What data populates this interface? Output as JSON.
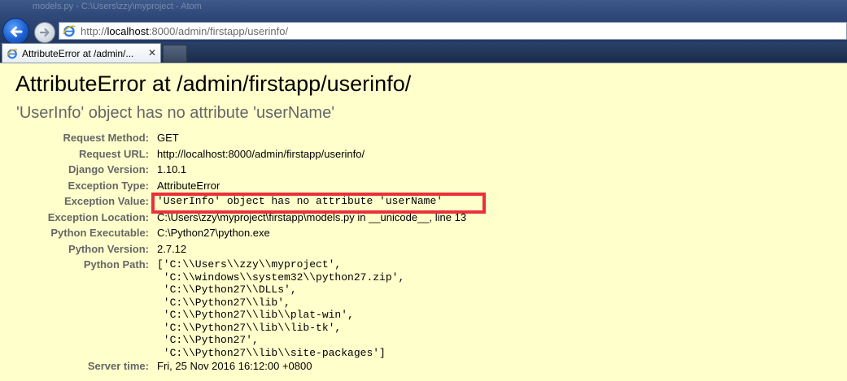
{
  "browser": {
    "window_title": "models.py - C:\\Users\\zzy\\myproject - Atom",
    "address_url": "http://localhost:8000/admin/firstapp/userinfo/",
    "url_scheme": "http://",
    "url_host": "localhost",
    "url_rest": ":8000/admin/firstapp/userinfo/",
    "tab_title": "AttributeError at /admin/...",
    "tab_close": "✕",
    "icons": [
      "back-arrow-icon",
      "forward-arrow-icon",
      "ie-page-icon",
      "ie-tab-icon",
      "tab-close-icon"
    ],
    "accent_color": "#1d5fd0"
  },
  "page": {
    "title": "AttributeError at /admin/firstapp/userinfo/",
    "subtitle": "'UserInfo' object has no attribute 'userName'",
    "background": "#ffffcc",
    "highlight_color": "#e8323a",
    "meta": [
      {
        "key": "Request Method:",
        "value": "GET"
      },
      {
        "key": "Request URL:",
        "value": "http://localhost:8000/admin/firstapp/userinfo/"
      },
      {
        "key": "Django Version:",
        "value": "1.10.1"
      },
      {
        "key": "Exception Type:",
        "value": "AttributeError"
      },
      {
        "key": "Exception Value:",
        "value": "'UserInfo' object has no attribute 'userName'"
      },
      {
        "key": "Exception Location:",
        "value": "C:\\Users\\zzy\\myproject\\firstapp\\models.py in __unicode__, line 13"
      },
      {
        "key": "Python Executable:",
        "value": "C:\\Python27\\python.exe"
      },
      {
        "key": "Python Version:",
        "value": "2.7.12"
      },
      {
        "key": "Python Path:",
        "value": ""
      },
      {
        "key": "Server time:",
        "value": "Fri, 25 Nov 2016 16:12:00 +0800"
      }
    ],
    "python_path": [
      "['C:\\\\Users\\\\zzy\\\\myproject',",
      " 'C:\\\\windows\\\\system32\\\\python27.zip',",
      " 'C:\\\\Python27\\\\DLLs',",
      " 'C:\\\\Python27\\\\lib',",
      " 'C:\\\\Python27\\\\lib\\\\plat-win',",
      " 'C:\\\\Python27\\\\lib\\\\lib-tk',",
      " 'C:\\\\Python27',",
      " 'C:\\\\Python27\\\\lib\\\\site-packages']"
    ]
  }
}
